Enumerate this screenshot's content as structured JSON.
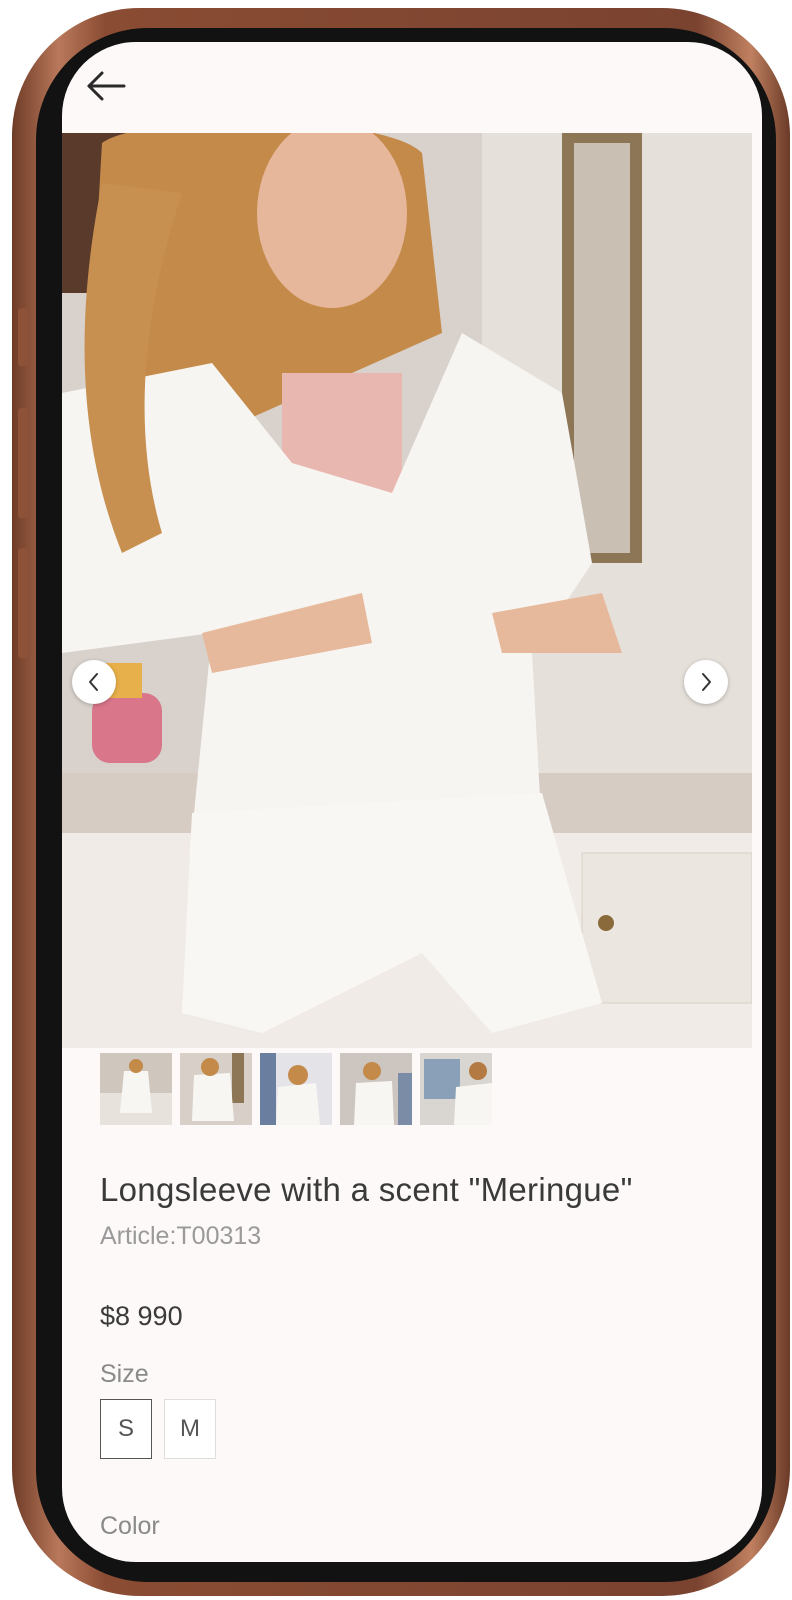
{
  "nav": {
    "back_icon": "arrow-left-icon"
  },
  "gallery": {
    "prev_icon": "chevron-left-icon",
    "next_icon": "chevron-right-icon",
    "thumbnail_count": 5
  },
  "product": {
    "title": "Longsleeve with a scent \"Meringue\"",
    "article": "Article:T00313",
    "price": "$8 990"
  },
  "size": {
    "label": "Size",
    "options": [
      "S",
      "M"
    ],
    "selected": "S"
  },
  "color": {
    "label": "Color"
  },
  "colors": {
    "screen_bg": "#fdf9f8",
    "text": "#3a3a3a",
    "muted": "#9a9a9a",
    "frame": "#8a4c33"
  }
}
